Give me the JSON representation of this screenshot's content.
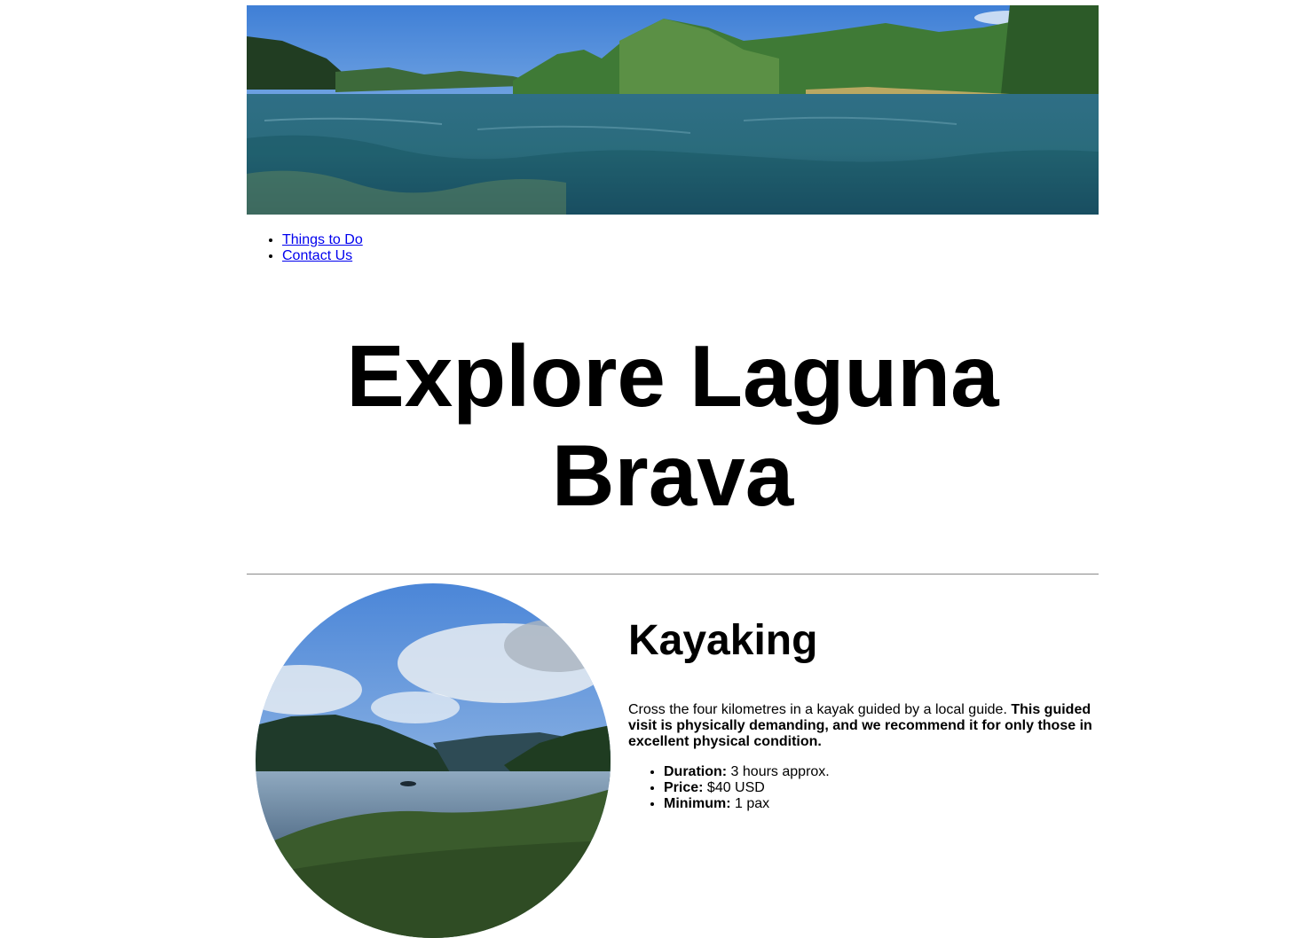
{
  "nav": {
    "items": [
      {
        "label": "Things to Do"
      },
      {
        "label": "Contact Us"
      }
    ]
  },
  "page_title": "Explore Laguna Brava",
  "activity": {
    "title": "Kayaking",
    "description": "Cross the four kilometres in a kayak guided by a local guide. ",
    "description_bold": "This guided visit is physically demanding, and we recommend it for only those in excellent physical condition.",
    "details": [
      {
        "label": "Duration:",
        "value": " 3 hours approx."
      },
      {
        "label": "Price:",
        "value": " $40 USD"
      },
      {
        "label": "Minimum:",
        "value": " 1 pax"
      }
    ]
  },
  "colors": {
    "link": "#0000ee",
    "divider": "#8a8a8a"
  }
}
